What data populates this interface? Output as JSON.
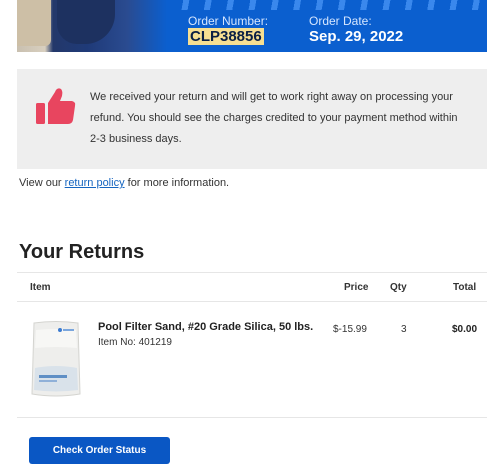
{
  "order": {
    "number_label": "Order Number:",
    "number_value": "CLP38856",
    "date_label": "Order Date:",
    "date_value": "Sep. 29, 2022"
  },
  "notice": {
    "icon": "thumbs-up-icon",
    "message": "We received your return and will get to work right away on processing your refund. You should see the charges credited to your payment method within 2-3 business days."
  },
  "policy": {
    "prefix": "View our ",
    "link_text": "return policy",
    "suffix": " for more information."
  },
  "returns": {
    "title": "Your Returns",
    "columns": {
      "item": "Item",
      "price": "Price",
      "qty": "Qty",
      "total": "Total"
    },
    "items": [
      {
        "name": "Pool Filter Sand, #20 Grade Silica, 50 lbs.",
        "item_no": "Item No: 401219",
        "price": "$-15.99",
        "qty": "3",
        "total": "$0.00"
      }
    ]
  },
  "actions": {
    "check_status": "Check Order Status"
  },
  "colors": {
    "brand_blue": "#0b5fcf",
    "highlight": "#f6df92",
    "thumb_pink": "#e8455f"
  }
}
